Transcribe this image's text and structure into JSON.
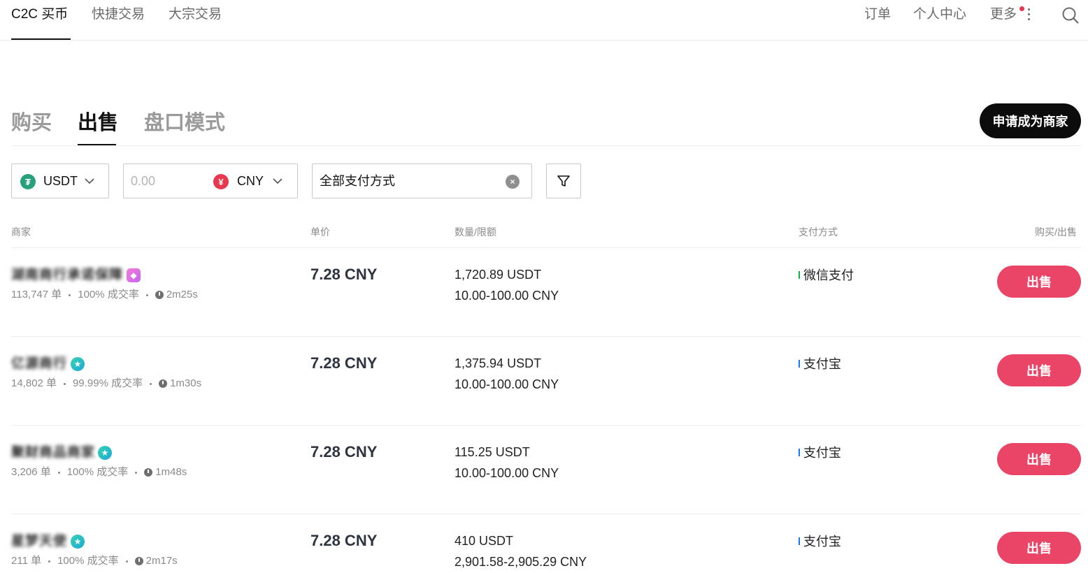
{
  "colors": {
    "accent_sell": "#ea4466",
    "primary_dark": "#0c0c0c",
    "usdt_green": "#26a17b",
    "cny_red": "#e8384f",
    "wechat_green": "#09b83e",
    "alipay_blue": "#1677ff"
  },
  "nav": {
    "items": [
      {
        "label": "C2C 买币",
        "active": true
      },
      {
        "label": "快捷交易",
        "active": false
      },
      {
        "label": "大宗交易",
        "active": false
      }
    ],
    "right": {
      "orders": "订单",
      "profile": "个人中心",
      "more": "更多",
      "more_icon": "kebab-icon",
      "search_icon": "search-icon"
    }
  },
  "trade_tabs": [
    {
      "label": "购买",
      "active": false
    },
    {
      "label": "出售",
      "active": true
    },
    {
      "label": "盘口模式",
      "active": false
    }
  ],
  "become_merchant": "申请成为商家",
  "filters": {
    "coin": {
      "symbol": "₮",
      "label": "USDT"
    },
    "amount": {
      "placeholder": "0.00"
    },
    "fiat": {
      "symbol": "¥",
      "label": "CNY"
    },
    "payment": {
      "value": "全部支付方式",
      "clear_icon": "clear-icon"
    },
    "filter_icon": "funnel-icon"
  },
  "table": {
    "headers": {
      "merchant": "商家",
      "price": "单价",
      "quantity": "数量/限额",
      "payment": "支付方式",
      "action": "购买/出售"
    },
    "rows": [
      {
        "merchant": "湖南商行承诺保障",
        "badge": "diamond-badge-icon",
        "orders": "113,747 单",
        "completion": "100% 成交率",
        "time": "2m25s",
        "price": "7.28 CNY",
        "quantity": "1,720.89 USDT",
        "limit": "10.00-100.00 CNY",
        "payment": "微信支付",
        "payment_color": "#09b83e",
        "action": "出售"
      },
      {
        "merchant": "亿源商行",
        "badge": "verified-badge-icon",
        "orders": "14,802 单",
        "completion": "99.99% 成交率",
        "time": "1m30s",
        "price": "7.28 CNY",
        "quantity": "1,375.94 USDT",
        "limit": "10.00-100.00 CNY",
        "payment": "支付宝",
        "payment_color": "#1677ff",
        "action": "出售"
      },
      {
        "merchant": "聚财商品商家",
        "badge": "verified-badge-icon",
        "orders": "3,206 单",
        "completion": "100% 成交率",
        "time": "1m48s",
        "price": "7.28 CNY",
        "quantity": "115.25 USDT",
        "limit": "10.00-100.00 CNY",
        "payment": "支付宝",
        "payment_color": "#1677ff",
        "action": "出售"
      },
      {
        "merchant": "星梦天使",
        "badge": "verified-badge-icon",
        "orders": "211 单",
        "completion": "100% 成交率",
        "time": "2m17s",
        "price": "7.28 CNY",
        "quantity": "410 USDT",
        "limit": "2,901.58-2,905.29 CNY",
        "payment": "支付宝",
        "payment_color": "#1677ff",
        "action": "出售"
      }
    ]
  }
}
